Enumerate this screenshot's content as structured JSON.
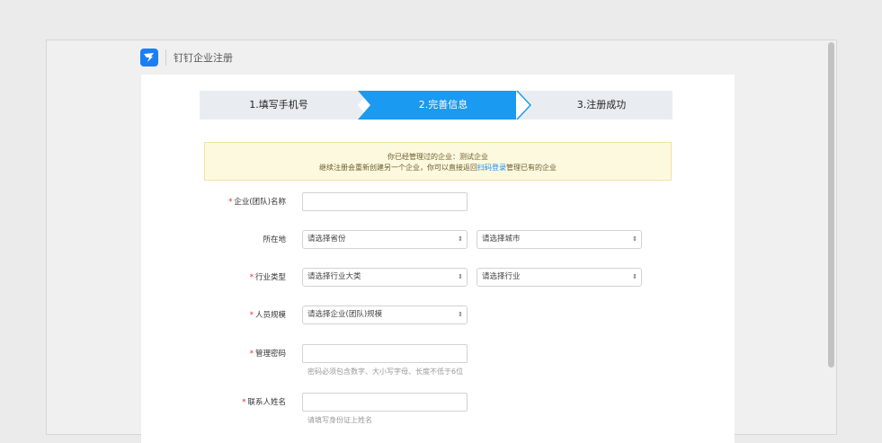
{
  "app": {
    "title": "钉钉企业注册"
  },
  "steps": [
    {
      "label": "1.填写手机号"
    },
    {
      "label": "2.完善信息"
    },
    {
      "label": "3.注册成功"
    }
  ],
  "notice": {
    "line1": "你已经管理过的企业：测试企业",
    "line2_prefix": "继续注册会重新创建另一个企业，你可以直接返回",
    "line2_link": "扫码登录",
    "line2_suffix": "管理已有的企业"
  },
  "form": {
    "company_name": {
      "label": "企业(团队)名称",
      "required": "*",
      "value": ""
    },
    "location": {
      "label": "所在地",
      "province_placeholder": "请选择省份",
      "city_placeholder": "请选择城市"
    },
    "industry": {
      "label": "行业类型",
      "required": "*",
      "category_placeholder": "请选择行业大类",
      "industry_placeholder": "请选择行业"
    },
    "staff_size": {
      "label": "人员规模",
      "required": "*",
      "placeholder": "请选择企业(团队)规模"
    },
    "password": {
      "label": "管理密码",
      "required": "*",
      "hint": "密码必须包含数字、大小写字母、长度不低于6位"
    },
    "contact_name": {
      "label": "联系人姓名",
      "required": "*",
      "hint": "请填写身份证上姓名"
    }
  },
  "colors": {
    "accent": "#1a9af0",
    "step_inactive": "#e9edf2",
    "required": "#e0302e"
  }
}
